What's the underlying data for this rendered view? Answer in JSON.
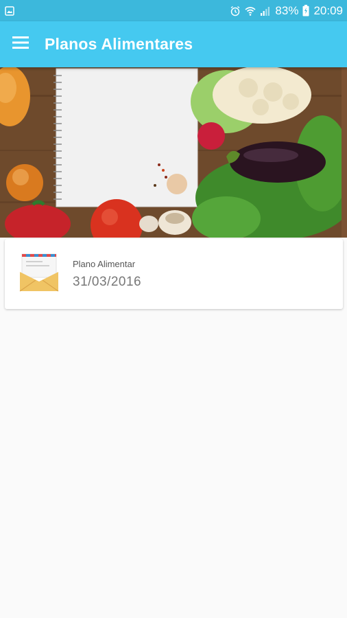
{
  "status_bar": {
    "battery": "83%",
    "time": "20:09",
    "icons": [
      "image-icon",
      "alarm-icon",
      "wifi-icon",
      "signal-icon",
      "battery-icon"
    ]
  },
  "app_bar": {
    "title": "Planos Alimentares",
    "menu_icon": "hamburger-menu-icon",
    "color": "#45c9f0"
  },
  "hero": {
    "image": "notebook-with-vegetables-illustration"
  },
  "plans": [
    {
      "label": "Plano Alimentar",
      "date": "31/03/2016",
      "icon": "envelope-icon"
    }
  ]
}
